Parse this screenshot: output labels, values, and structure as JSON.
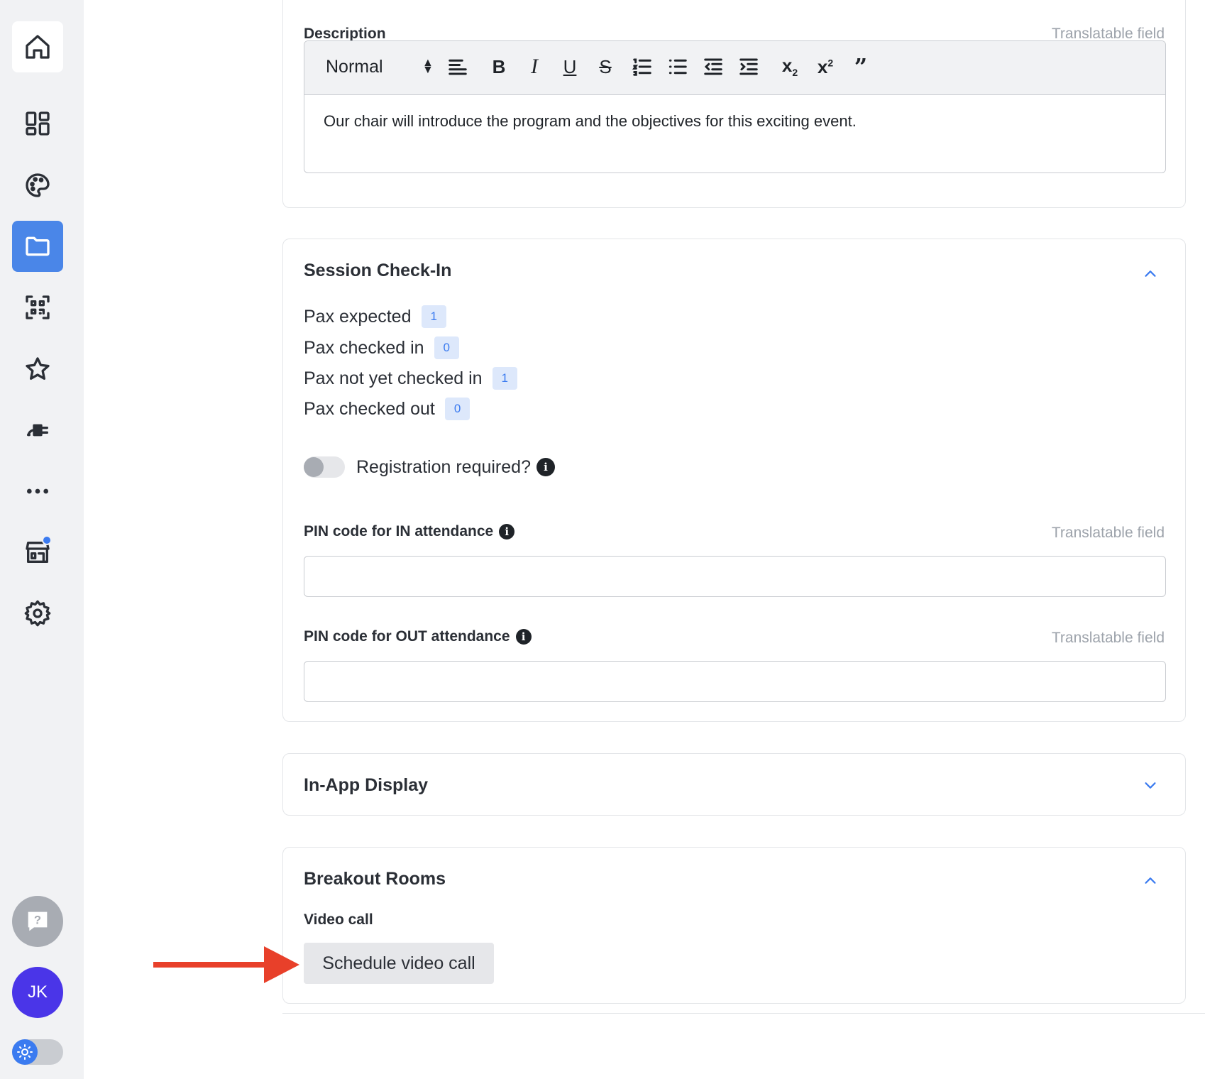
{
  "sidebar": {
    "items": [
      {
        "icon": "home-icon"
      },
      {
        "icon": "dashboard-icon"
      },
      {
        "icon": "palette-icon"
      },
      {
        "icon": "folder-icon",
        "active": true
      },
      {
        "icon": "qr-code-icon"
      },
      {
        "icon": "star-icon"
      },
      {
        "icon": "plug-icon"
      },
      {
        "icon": "more-icon"
      },
      {
        "icon": "store-icon",
        "notification": true
      },
      {
        "icon": "gear-icon"
      }
    ],
    "help_icon": "help-chat-icon",
    "avatar_initials": "JK",
    "theme_icon": "sun-icon"
  },
  "description": {
    "label": "Description",
    "translatable": "Translatable field",
    "format_select": "Normal",
    "toolbar": [
      "align-left",
      "bold",
      "italic",
      "underline",
      "strikethrough",
      "ordered-list",
      "bullet-list",
      "outdent",
      "indent",
      "subscript",
      "superscript",
      "blockquote"
    ],
    "content": "Our chair will introduce the program and the objectives for this exciting event."
  },
  "checkin": {
    "title": "Session Check-In",
    "stats": [
      {
        "label": "Pax expected",
        "value": "1"
      },
      {
        "label": "Pax checked in",
        "value": "0"
      },
      {
        "label": "Pax not yet checked in",
        "value": "1"
      },
      {
        "label": "Pax checked out",
        "value": "0"
      }
    ],
    "registration_label": "Registration required?",
    "registration_enabled": false,
    "pin_in_label": "PIN code for IN attendance",
    "pin_in_translatable": "Translatable field",
    "pin_in_value": "",
    "pin_out_label": "PIN code for OUT attendance",
    "pin_out_translatable": "Translatable field",
    "pin_out_value": ""
  },
  "inapp": {
    "title": "In-App Display"
  },
  "breakout": {
    "title": "Breakout Rooms",
    "video_label": "Video call",
    "schedule_button": "Schedule video call"
  },
  "colors": {
    "accent": "#3b7bf0",
    "active_nav": "#4a86e8",
    "avatar": "#4a35e8",
    "arrow": "#e8402a"
  }
}
